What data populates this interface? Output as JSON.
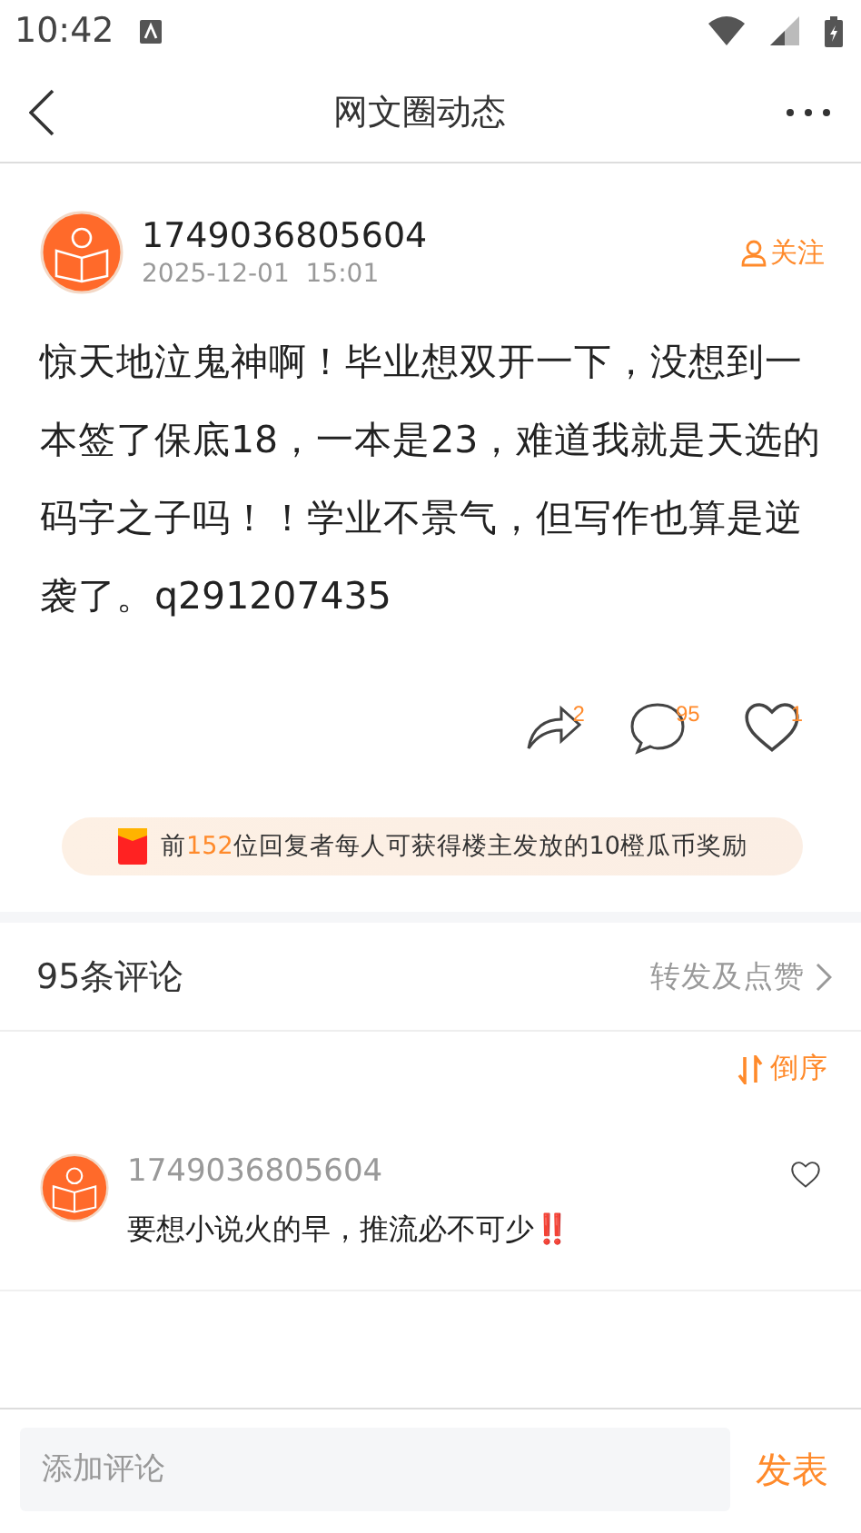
{
  "status_bar": {
    "time": "10:42"
  },
  "nav": {
    "title": "网文圈动态"
  },
  "post": {
    "author": "1749036805604",
    "time": "2025-12-01  15:01",
    "follow": "关注",
    "following": false,
    "body": "惊天地泣鬼神啊！毕业想双开一下，没想到一本签了保底18，一本是23，难道我就是天选的码字之子吗！！学业不景气，但写作也算是逆袭了。q291207435",
    "actions": [
      {
        "kind": "share",
        "count": "2"
      },
      {
        "kind": "comment",
        "count": "95"
      },
      {
        "kind": "like",
        "count": "1",
        "liked": false
      }
    ],
    "reward": {
      "parts": [
        {
          "text": "前",
          "highlight": false
        },
        {
          "text": "152",
          "highlight": true
        },
        {
          "text": "位回复者每人可获得楼主发放的10橙瓜币奖励",
          "highlight": false
        }
      ]
    }
  },
  "comments_header": {
    "title": "95条评论",
    "link": "转发及点赞"
  },
  "sort": {
    "label": "倒序"
  },
  "comments": [
    {
      "author": "1749036805604",
      "text": "要想小说火的早，推流必不可少‼️",
      "liked": false
    }
  ],
  "composer": {
    "placeholder": "添加评论",
    "send": "发表"
  }
}
